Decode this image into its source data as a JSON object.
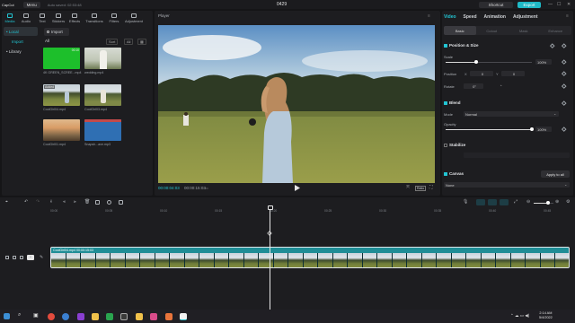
{
  "titlebar": {
    "app_name": "CapCut",
    "menu_label": "Menu",
    "autosave": "Auto saved: 02:53:48",
    "project_name": "0429",
    "shortcut_label": "Shortcut",
    "export_label": "Export",
    "minimize": "—",
    "maximize": "☐",
    "close": "✕"
  },
  "left_panel": {
    "tabs": [
      {
        "label": "Media",
        "icon": "media-icon",
        "active": true
      },
      {
        "label": "Audio",
        "icon": "audio-icon"
      },
      {
        "label": "Text",
        "icon": "text-icon"
      },
      {
        "label": "Stickers",
        "icon": "stickers-icon"
      },
      {
        "label": "Effects",
        "icon": "effects-icon"
      },
      {
        "label": "Transitions",
        "icon": "transitions-icon"
      },
      {
        "label": "Filters",
        "icon": "filters-icon"
      },
      {
        "label": "Adjustment",
        "icon": "adjustment-icon"
      }
    ],
    "nav": [
      {
        "label": "• Local",
        "active": true
      },
      {
        "label": "Import"
      },
      {
        "label": "• Library"
      }
    ],
    "import_label": "Import",
    "all_label": "All",
    "sort_label": "Sort",
    "filter_label": "All",
    "media": [
      {
        "caption": "4K GREEN_SCREE...mp4",
        "duration": "00:10",
        "kind": "green"
      },
      {
        "caption": "wedding.mp4",
        "duration": "",
        "kind": "wedding"
      },
      {
        "caption": "CoolGirl04.mp4",
        "duration": "",
        "badge": "Added",
        "kind": "field"
      },
      {
        "caption": "CoolGirl03.mp4",
        "duration": "",
        "kind": "field2"
      },
      {
        "caption": "CoolGirl01.mp4",
        "duration": "",
        "kind": "sunset"
      },
      {
        "caption": "Snapsh...ave.mp3",
        "duration": "",
        "kind": "audio"
      }
    ]
  },
  "player": {
    "title": "Player",
    "current_time": "00:00:04:03",
    "total_time": "00:00:15:03",
    "ratio_label": "Ratio"
  },
  "right_panel": {
    "tabs": [
      "Video",
      "Speed",
      "Animation",
      "Adjustment"
    ],
    "subtabs": [
      "Basic",
      "Cutout",
      "Mask",
      "Enhance"
    ],
    "position_size": "Position & Size",
    "scale_label": "Scale",
    "scale_value": "100%",
    "scale_fraction": 0.35,
    "position_label": "Position",
    "pos_x_label": "X",
    "pos_x": "0",
    "pos_y_label": "Y",
    "pos_y": "0",
    "rotate_label": "Rotate",
    "rotate_value": "0°",
    "blend": "Blend",
    "mode_label": "Mode",
    "mode_value": "Normal",
    "opacity_label": "Opacity",
    "opacity_value": "100%",
    "opacity_fraction": 1.0,
    "stabilize": "Stabilize",
    "canvas": "Canvas",
    "apply_all": "Apply to all",
    "canvas_value": "None"
  },
  "timeline": {
    "ruler_ticks": [
      "00:00",
      "00:05",
      "00:10",
      "00:15",
      "00:20",
      "00:25",
      "00:30",
      "00:35",
      "00:40",
      "00:45"
    ],
    "clip_label": "CoolGirl04.mp4  00:00:15:03"
  },
  "taskbar": {
    "time": "2:14 AM",
    "date": "5/4/2022"
  },
  "colors": {
    "accent": "#22c5d3",
    "clip": "#1f8d96"
  }
}
